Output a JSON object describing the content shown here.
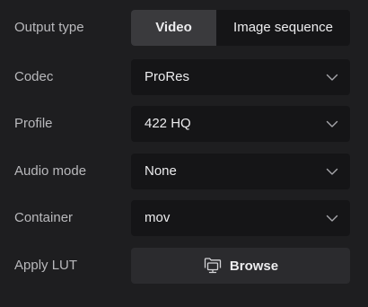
{
  "output_type": {
    "label": "Output type",
    "options": [
      "Video",
      "Image sequence"
    ],
    "selected": "Video"
  },
  "codec": {
    "label": "Codec",
    "value": "ProRes",
    "icon": "chevron-down-icon"
  },
  "profile": {
    "label": "Profile",
    "value": "422 HQ",
    "icon": "chevron-down-icon"
  },
  "audio_mode": {
    "label": "Audio mode",
    "value": "None",
    "icon": "chevron-down-icon"
  },
  "container": {
    "label": "Container",
    "value": "mov",
    "icon": "chevron-down-icon"
  },
  "apply_lut": {
    "label": "Apply LUT",
    "button_label": "Browse",
    "icon": "folder-monitor-icon"
  },
  "colors": {
    "background": "#1e1e20",
    "control_background": "#151517",
    "active_segment": "#3a3a3d",
    "button_background": "#2b2b2e",
    "label_text": "#b9b9bc",
    "value_text": "#ececee"
  }
}
